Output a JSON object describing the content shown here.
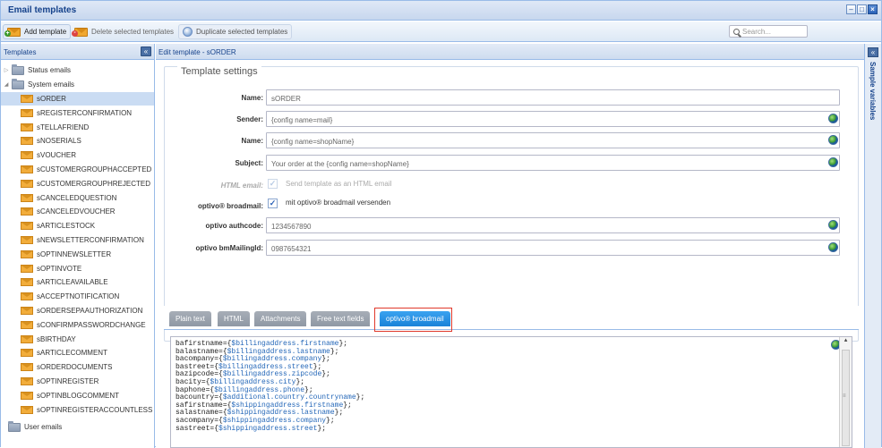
{
  "window": {
    "title": "Email templates"
  },
  "toolbar": {
    "add_label": "Add template",
    "delete_label": "Delete selected templates",
    "duplicate_label": "Duplicate selected templates",
    "search_placeholder": "Search..."
  },
  "left": {
    "header": "Templates",
    "folders": {
      "status": "Status emails",
      "system": "System emails",
      "user": "User emails"
    },
    "templates": [
      "sORDER",
      "sREGISTERCONFIRMATION",
      "sTELLAFRIEND",
      "sNOSERIALS",
      "sVOUCHER",
      "sCUSTOMERGROUPHACCEPTED",
      "sCUSTOMERGROUPHREJECTED",
      "sCANCELEDQUESTION",
      "sCANCELEDVOUCHER",
      "sARTICLESTOCK",
      "sNEWSLETTERCONFIRMATION",
      "sOPTINNEWSLETTER",
      "sOPTINVOTE",
      "sARTICLEAVAILABLE",
      "sACCEPTNOTIFICATION",
      "sORDERSEPAAUTHORIZATION",
      "sCONFIRMPASSWORDCHANGE",
      "sBIRTHDAY",
      "sARTICLECOMMENT",
      "sORDERDOCUMENTS",
      "sOPTINREGISTER",
      "sOPTINBLOGCOMMENT",
      "sOPTINREGISTERACCOUNTLESS"
    ],
    "selected": "sORDER"
  },
  "main": {
    "header": "Edit template - sORDER",
    "legend": "Template settings",
    "fields": {
      "name_label": "Name:",
      "name_value": "sORDER",
      "sender_label": "Sender:",
      "sender_value": "{config name=mail}",
      "fromname_label": "Name:",
      "fromname_value": "{config name=shopName}",
      "subject_label": "Subject:",
      "subject_value": "Your order at the {config name=shopName}",
      "html_label": "HTML email:",
      "html_checkbox_text": "Send template as an HTML email",
      "broadmail_label": "optivo® broadmail:",
      "broadmail_checkbox_text": "mit optivo® broadmail versenden",
      "authcode_label": "optivo authcode:",
      "authcode_value": "1234567890",
      "mailingid_label": "optivo bmMailingId:",
      "mailingid_value": "0987654321"
    },
    "tabs": [
      "Plain text",
      "HTML",
      "Attachments",
      "Free text fields",
      "optivo® broadmail"
    ],
    "active_tab": "optivo® broadmail",
    "editor_lines": [
      {
        "key": "bafirstname",
        "var": "$billingaddress.firstname"
      },
      {
        "key": "balastname",
        "var": "$billingaddress.lastname"
      },
      {
        "key": "bacompany",
        "var": "$billingaddress.company"
      },
      {
        "key": "bastreet",
        "var": "$billingaddress.street"
      },
      {
        "key": "bazipcode",
        "var": "$billingaddress.zipcode"
      },
      {
        "key": "bacity",
        "var": "$billingaddress.city"
      },
      {
        "key": "baphone",
        "var": "$billingaddress.phone"
      },
      {
        "key": "bacountry",
        "var": "$additional.country.countryname"
      },
      {
        "key": "safirstname",
        "var": "$shippingaddress.firstname"
      },
      {
        "key": "salastname",
        "var": "$shippingaddress.lastname"
      },
      {
        "key": "sacompany",
        "var": "$shippingaddress.company"
      },
      {
        "key": "sastreet",
        "var": "$shippingaddress.street"
      }
    ]
  },
  "right": {
    "label": "Sample variables"
  },
  "colors": {
    "accent": "#15428b",
    "tab_active": "#1a82d8",
    "highlight": "#e0392b"
  }
}
